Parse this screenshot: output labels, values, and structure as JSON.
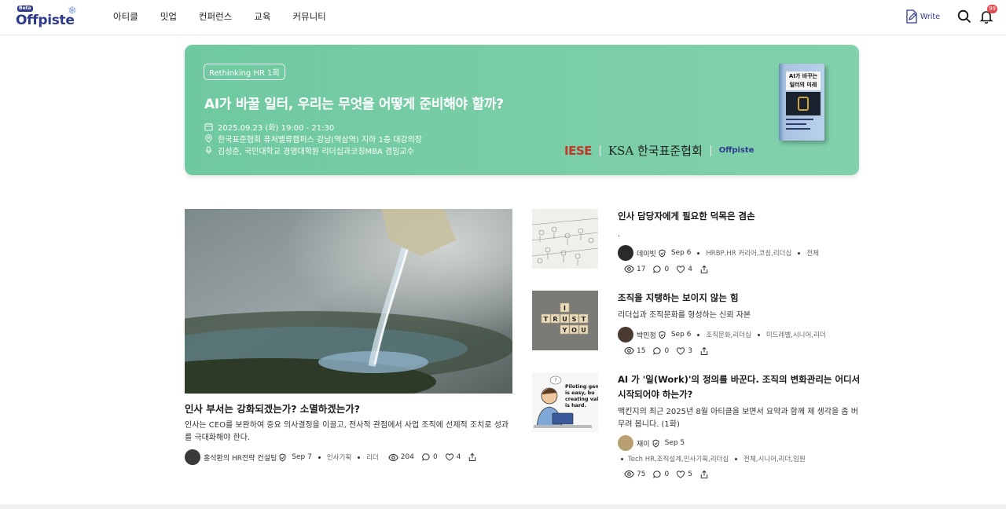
{
  "header": {
    "logo_badge": "Beta",
    "logo_text": "Offpiste",
    "nav": [
      "아티클",
      "밋업",
      "컨퍼런스",
      "교육",
      "커뮤니티"
    ],
    "write_label": "Write",
    "notif_count": "99"
  },
  "banner": {
    "tag": "Rethinking HR 1회",
    "title": "AI가 바꿀 일터, 우리는 무엇을 어떻게 준비해야 할까?",
    "date": "2025.09.23 (화) 19:00 - 21:30",
    "location": "한국표준협회 퓨처밸류캠퍼스 강남(역삼역) 지하 1층 대강의장",
    "speaker": "김성준, 국민대학교 경영대학원 리더십과코칭MBA 겸임교수",
    "logos": {
      "iese": "IESE",
      "ksa": "KSA 한국표준협회",
      "offpiste": "Offpiste"
    },
    "book_title": "AI가 바꾸는 일터의 미래",
    "bg_color": "#78cda6"
  },
  "featured": {
    "title": "인사 부서는 강화되겠는가? 소멸하겠는가?",
    "desc": "인사는 CEO를 보완하여 중요 의사결정을 이끌고, 전사적 관점에서 사업 조직에 선제적 조치로 성과를 극대화해야 한다.",
    "author": "홍석환의 HR전략 컨설팅",
    "date": "Sep 7",
    "tags": [
      "인사기획",
      "리더"
    ],
    "views": "204",
    "comments": "0",
    "likes": "4"
  },
  "articles": [
    {
      "title": "인사 담당자에게 필요한 덕목은 겸손",
      "desc": ".",
      "author": "데이빗",
      "date": "Sep 6",
      "tags": [
        "HRBP,HR 커리어,코칭,리더십",
        "전체"
      ],
      "views": "17",
      "comments": "0",
      "likes": "4"
    },
    {
      "title": "조직을 지탱하는 보이지 않는 힘",
      "desc": "리더십과 조직문화를 형성하는 신뢰 자본",
      "author": "박민정",
      "date": "Sep 6",
      "tags": [
        "조직문화,리더십",
        "미드레벨,시니어,리더"
      ],
      "views": "15",
      "comments": "0",
      "likes": "3"
    },
    {
      "title": "AI 가 '일(Work)'의 정의를 바꾼다. 조직의 변화관리는 어디서 시작되어야 하는가?",
      "desc": "맥킨지의 최근 2025년 8월 아티클을 보면서 요약과 함께 제 생각을 좀 버무려 봅니다. (1화)",
      "author": "재이",
      "date": "Sep 5",
      "tags": [
        "Tech HR,조직설계,인사기획,리더십",
        "전체,시니어,리더,임원"
      ],
      "views": "75",
      "comments": "0",
      "likes": "5",
      "thumb_text": "Piloting gen is easy, bu creating val is hard."
    }
  ]
}
